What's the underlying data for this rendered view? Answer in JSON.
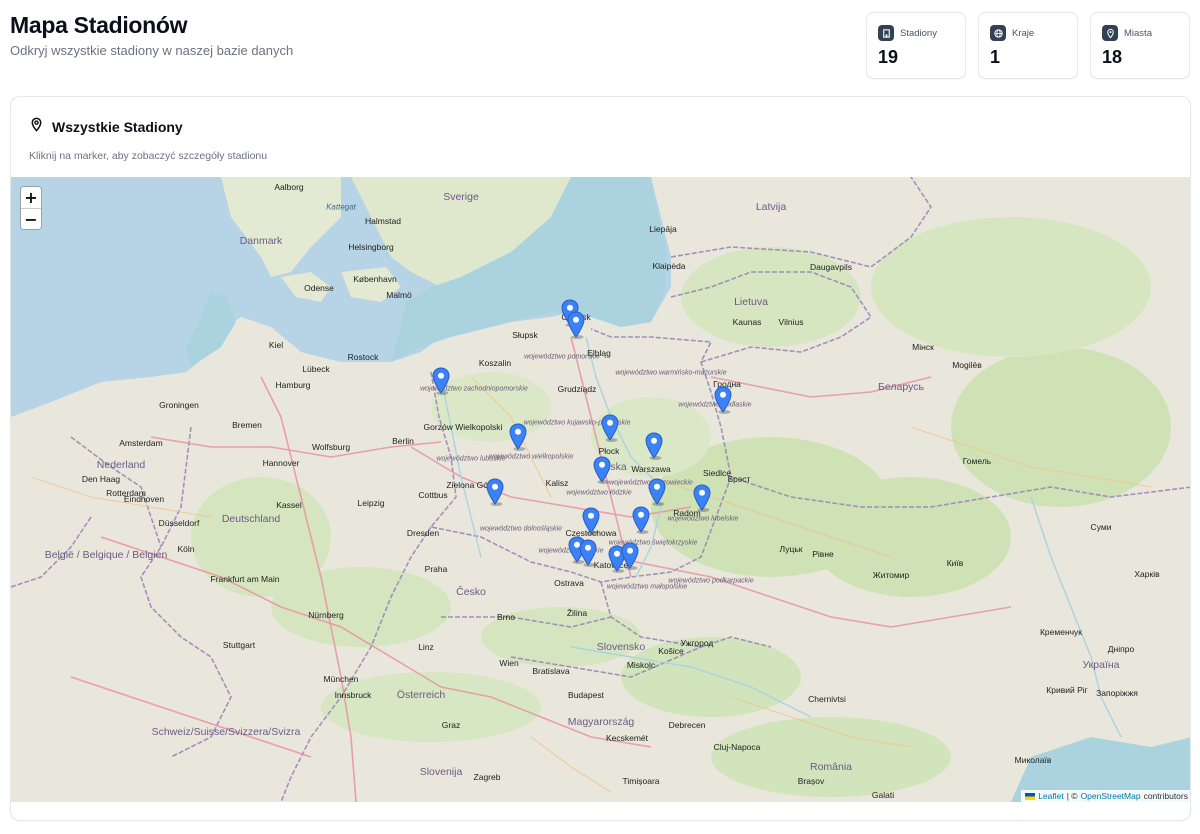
{
  "header": {
    "title": "Mapa Stadionów",
    "subtitle": "Odkryj wszystkie stadiony w naszej bazie danych"
  },
  "stats": [
    {
      "label": "Stadiony",
      "value": "19",
      "icon": "building-icon"
    },
    {
      "label": "Kraje",
      "value": "1",
      "icon": "globe-icon"
    },
    {
      "label": "Miasta",
      "value": "18",
      "icon": "map-pin-icon"
    }
  ],
  "card": {
    "title": "Wszystkie Stadiony",
    "description": "Kliknij na marker, aby zobaczyć szczegóły stadionu"
  },
  "map": {
    "zoom_in": "+",
    "zoom_out": "−",
    "attribution_leaflet": "Leaflet",
    "attribution_sep": "| ©",
    "attribution_osm": "OpenStreetMap",
    "attribution_tail": "contributors",
    "marker_color": "#3b82f6",
    "labels": {
      "countries": [
        "Danmark",
        "Deutschland",
        "Nederland",
        "België / Belgique / Belgien",
        "Česko",
        "Österreich",
        "Slovensko",
        "Magyarország",
        "Polska",
        "Lietuva",
        "Latvija",
        "Беларусь",
        "Україна",
        "România",
        "Slovenija",
        "Schweiz/Suisse/Svizzera/Svizra",
        "Sverige"
      ],
      "cities": [
        "Aalborg",
        "Halmstad",
        "Helsingborg",
        "København",
        "Odense",
        "Malmö",
        "Kiel",
        "Hamburg",
        "Bremen",
        "Lübeck",
        "Rostock",
        "Groningen",
        "Amsterdam",
        "Den Haag",
        "Rotterdam",
        "Eindhoven",
        "Düsseldorf",
        "Köln",
        "Frankfurt am Main",
        "Nürnberg",
        "München",
        "Stuttgart",
        "Leipzig",
        "Dresden",
        "Berlin",
        "Hannover",
        "Wolfsburg",
        "Kassel",
        "Praha",
        "Brno",
        "Wien",
        "Bratislava",
        "Budapest",
        "Zagreb",
        "Graz",
        "Linz",
        "Innsbruck",
        "Słupsk",
        "Koszalin",
        "Gdańsk",
        "Elbląg",
        "Grudziądz",
        "Gorzów Wielkopolski",
        "Zielona Góra",
        "Cottbus",
        "Płock",
        "Kalisz",
        "Warszawa",
        "Radom",
        "Częstochowa",
        "Katowice",
        "Ostrava",
        "Žilina",
        "Siedlce",
        "Kaunas",
        "Vilnius",
        "Klaipėda",
        "Liepāja",
        "Daugavpils",
        "Гродна",
        "Брэст",
        "Мінск",
        "Гомель",
        "Mogilёв",
        "Київ",
        "Житомир",
        "Рівне",
        "Луцьк",
        "Миколаїв",
        "Кременчук",
        "Дніпро",
        "Харків",
        "Суми",
        "Кривий Ріг",
        "Запоріжжя",
        "Cluj-Napoca",
        "Timișoara",
        "Debrecen",
        "Miskolc",
        "Košice",
        "Ужгород",
        "Kecskemét",
        "Chernivtsi",
        "Galati",
        "Brașov"
      ],
      "regions": [
        "województwo pomorskie",
        "województwo zachodniopomorskie",
        "województwo wielkopolskie",
        "województwo lubuskie",
        "województwo dolnośląskie",
        "województwo łódzkie",
        "województwo mazowieckie",
        "województwo lubelskie",
        "województwo podlaskie",
        "województwo świętokrzyskie",
        "województwo śląskie",
        "województwo małopolskie",
        "województwo podkarpackie",
        "województwo kujawsko-pomorskie",
        "województwo warmińsko-mazurskie"
      ],
      "seas": [
        "Kattegat"
      ]
    }
  }
}
